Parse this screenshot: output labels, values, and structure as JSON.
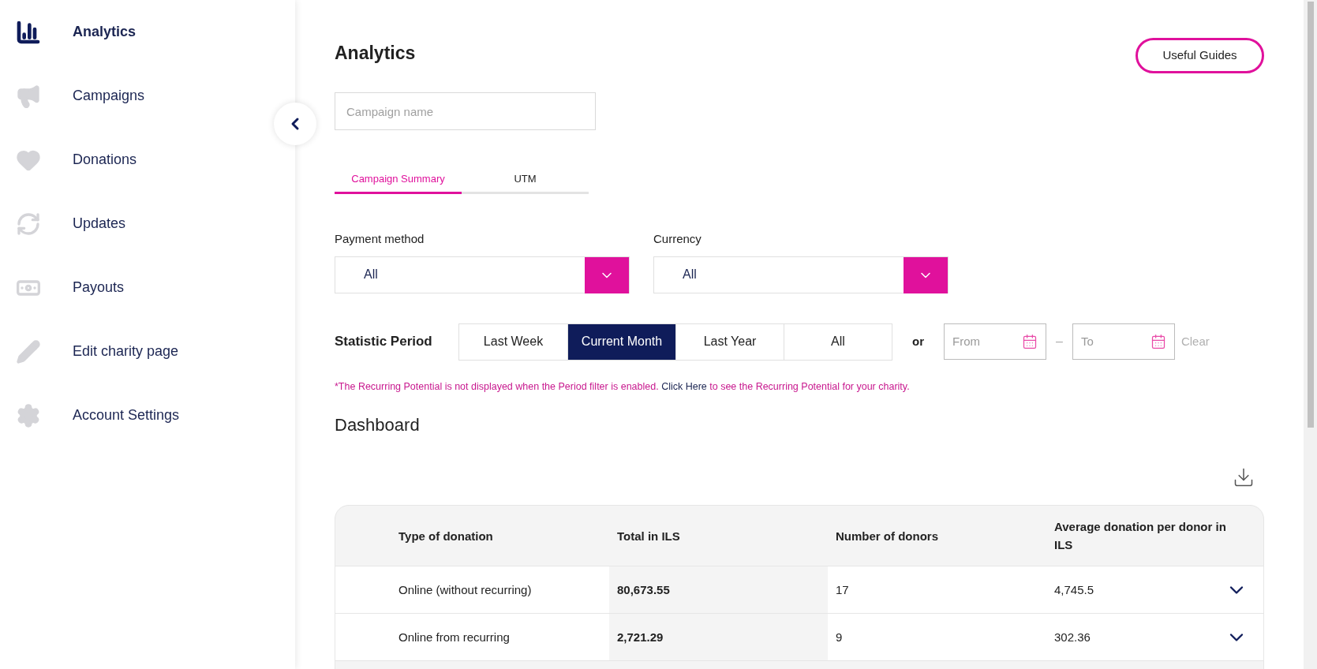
{
  "sidebar": {
    "items": [
      {
        "label": "Analytics",
        "kind": "bars",
        "selected": true
      },
      {
        "label": "Campaigns",
        "kind": "megaphone",
        "selected": false
      },
      {
        "label": "Donations",
        "kind": "heart",
        "selected": false
      },
      {
        "label": "Updates",
        "kind": "refresh",
        "selected": false
      },
      {
        "label": "Payouts",
        "kind": "money",
        "selected": false
      },
      {
        "label": "Edit charity page",
        "kind": "pencil",
        "selected": false
      },
      {
        "label": "Account Settings",
        "kind": "gear",
        "selected": false
      }
    ]
  },
  "page": {
    "title": "Analytics",
    "guides_button": "Useful Guides"
  },
  "search": {
    "placeholder": "Campaign name"
  },
  "tabs": [
    {
      "label": "Campaign Summary",
      "selected": true
    },
    {
      "label": "UTM",
      "selected": false
    }
  ],
  "filters": [
    {
      "label": "Payment method",
      "value": "All"
    },
    {
      "label": "Currency",
      "value": "All"
    }
  ],
  "period": {
    "label": "Statistic Period",
    "options": [
      {
        "label": "Last Week",
        "selected": false
      },
      {
        "label": "Current Month",
        "selected": true
      },
      {
        "label": "Last Year",
        "selected": false
      },
      {
        "label": "All",
        "selected": false
      }
    ],
    "or": "or",
    "from_placeholder": "From",
    "dash": "–",
    "to_placeholder": "To",
    "clear": "Clear"
  },
  "note": {
    "before": "*The Recurring Potential is not displayed when the Period filter is enabled. ",
    "link": "Click Here",
    "after": " to see the Recurring Potential for your charity."
  },
  "dashboard": {
    "title": "Dashboard"
  },
  "table": {
    "columns": [
      "Type of donation",
      "Total in ILS",
      "Number of donors",
      "Average donation per donor in ILS"
    ],
    "rows": [
      [
        "Online (without recurring)",
        "80,673.55",
        "17",
        "4,745.5"
      ],
      [
        "Online from recurring",
        "2,721.29",
        "9",
        "302.36"
      ]
    ]
  }
}
